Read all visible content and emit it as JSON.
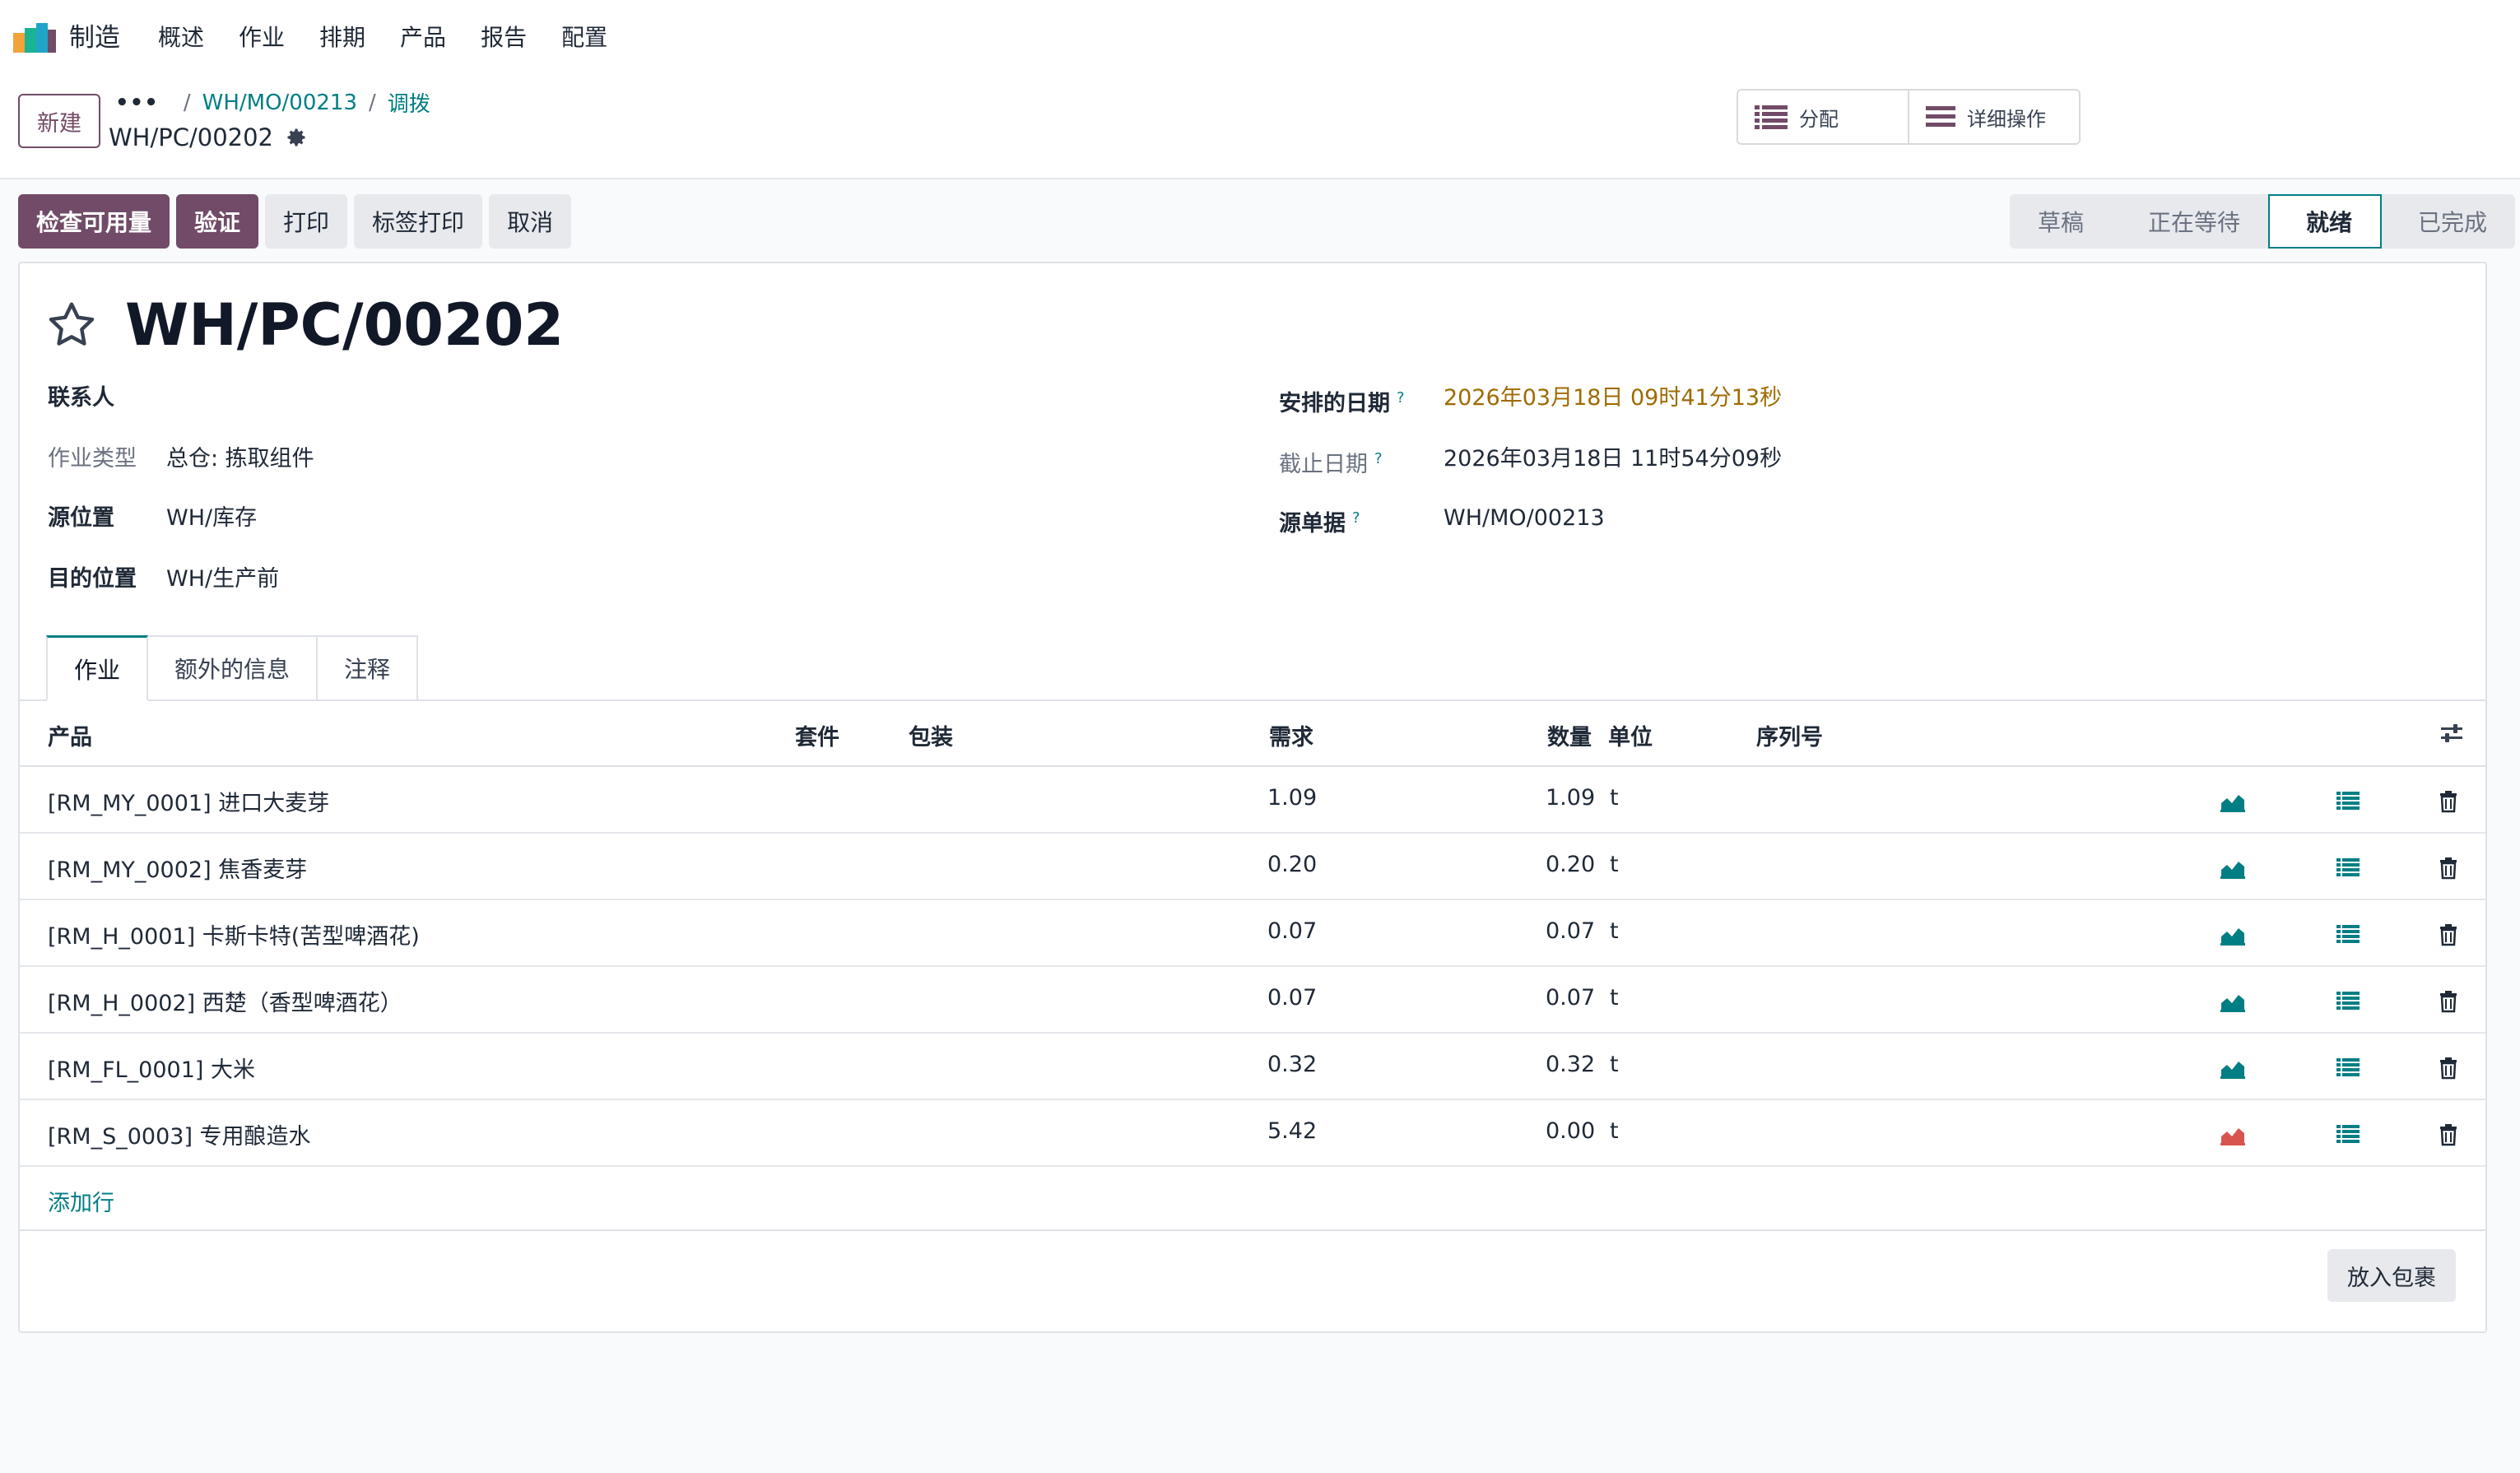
{
  "navbar": {
    "app_name": "制造",
    "menu": [
      "概述",
      "作业",
      "排期",
      "产品",
      "报告",
      "配置"
    ]
  },
  "control_panel": {
    "new_label": "新建",
    "breadcrumb": {
      "dots": "•••",
      "parent": "WH/MO/00213",
      "current": "调拨"
    },
    "record_name": "WH/PC/00202",
    "smart_buttons": [
      "分配",
      "详细操作"
    ]
  },
  "actions": [
    "检查可用量",
    "验证",
    "打印",
    "标签打印",
    "取消"
  ],
  "statusbar": {
    "steps": [
      "草稿",
      "正在等待",
      "就绪",
      "已完成"
    ],
    "active": "就绪"
  },
  "form": {
    "title": "WH/PC/00202",
    "left": {
      "contact_label": "联系人",
      "op_type_label": "作业类型",
      "op_type_value": "总仓: 拣取组件",
      "src_label": "源位置",
      "src_value": "WH/库存",
      "dest_label": "目的位置",
      "dest_value": "WH/生产前"
    },
    "right": {
      "scheduled_label": "安排的日期",
      "scheduled_value": "2026年03月18日 09时41分13秒",
      "deadline_label": "截止日期",
      "deadline_value": "2026年03月18日 11时54分09秒",
      "origin_label": "源单据",
      "origin_value": "WH/MO/00213"
    },
    "help_mark": "?",
    "tabs": [
      "作业",
      "额外的信息",
      "注释"
    ]
  },
  "table": {
    "headers": {
      "product": "产品",
      "kit": "套件",
      "packaging": "包装",
      "demand": "需求",
      "quantity": "数量",
      "uom": "单位",
      "serial": "序列号"
    },
    "rows": [
      {
        "product": "[RM_MY_0001] 进口大麦芽",
        "demand": "1.09",
        "quantity": "1.09",
        "uom": "t",
        "forecast": "ok"
      },
      {
        "product": "[RM_MY_0002] 焦香麦芽",
        "demand": "0.20",
        "quantity": "0.20",
        "uom": "t",
        "forecast": "ok"
      },
      {
        "product": "[RM_H_0001] 卡斯卡特(苦型啤酒花)",
        "demand": "0.07",
        "quantity": "0.07",
        "uom": "t",
        "forecast": "ok"
      },
      {
        "product": "[RM_H_0002] 西楚（香型啤酒花）",
        "demand": "0.07",
        "quantity": "0.07",
        "uom": "t",
        "forecast": "ok"
      },
      {
        "product": "[RM_FL_0001] 大米",
        "demand": "0.32",
        "quantity": "0.32",
        "uom": "t",
        "forecast": "ok"
      },
      {
        "product": "[RM_S_0003] 专用酿造水",
        "demand": "5.42",
        "quantity": "0.00",
        "uom": "t",
        "forecast": "short"
      }
    ],
    "add_line": "添加行"
  },
  "put_in_pack": "放入包裹",
  "colors": {
    "brand": "#714b67",
    "accent": "#017e84",
    "warning": "#a06a00",
    "danger": "#d9534f"
  }
}
